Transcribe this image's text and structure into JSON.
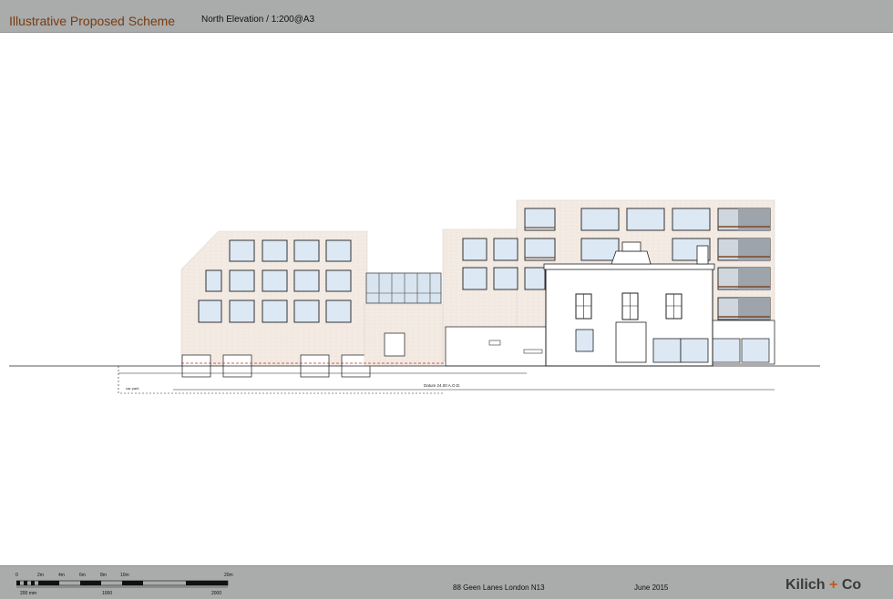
{
  "header": {
    "title": "Illustrative Proposed Scheme",
    "subtitle": "North Elevation / 1:200@A3"
  },
  "drawing": {
    "annotations": {
      "datum": "Datum 24.00 A.O.D.",
      "car_park": "car park"
    }
  },
  "footer": {
    "address": "88 Geen Lanes London N13",
    "date": "June 2015",
    "brand_name": "Kilich",
    "brand_plus": "+",
    "brand_suffix": "Co",
    "scale_bar": {
      "ticks": [
        "0",
        "2m",
        "4m",
        "6m",
        "8m",
        "10m",
        "20m"
      ],
      "sub_labels": [
        "200 mm",
        "1000",
        "2000"
      ]
    }
  },
  "colors": {
    "header_bg": "#a9acab",
    "brand_accent": "#c8561b",
    "title_color": "#7a3b10",
    "facade_brick": "#f3ebe4",
    "glazing": "#dce8f4"
  }
}
